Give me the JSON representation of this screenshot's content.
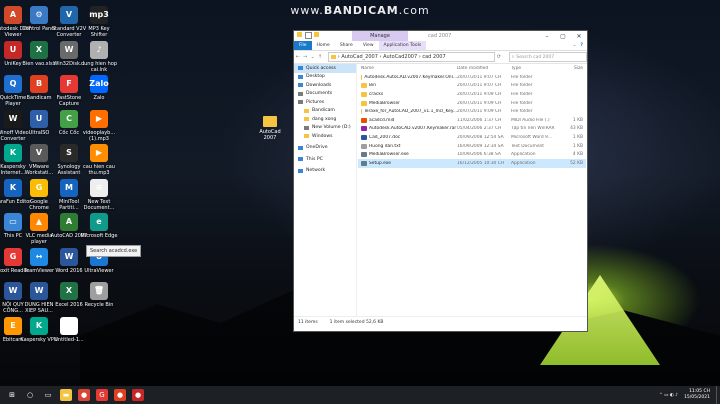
{
  "watermark": {
    "prefix": "www.",
    "brand": "BANDICAM",
    "suffix": ".com"
  },
  "desktop_icons": [
    {
      "label": "Autodesk DWF Viewer",
      "color": "#d04a2a",
      "glyph": "A"
    },
    {
      "label": "Control Panel",
      "color": "#3a79c4",
      "glyph": "⚙"
    },
    {
      "label": "Standard V2V Converter",
      "color": "#2266aa",
      "glyph": "V"
    },
    {
      "label": "MP3 Key Shifter",
      "color": "#222222",
      "glyph": "mp3"
    },
    {
      "label": "UniKey",
      "color": "#c62828",
      "glyph": "U"
    },
    {
      "label": "Bien vao.xlsx",
      "color": "#1e7145",
      "glyph": "X"
    },
    {
      "label": "Win32Disk...",
      "color": "#6a6a6a",
      "glyph": "W"
    },
    {
      "label": "dung hien hop cai.lnk",
      "color": "#b0b0b0",
      "glyph": "♪"
    },
    {
      "label": "QuickTime Player",
      "color": "#1f6fd1",
      "glyph": "Q"
    },
    {
      "label": "Bandicam",
      "color": "#e04020",
      "glyph": "B"
    },
    {
      "label": "FastStone Capture",
      "color": "#e53935",
      "glyph": "F"
    },
    {
      "label": "Zalo",
      "color": "#0068ff",
      "glyph": "Zalo"
    },
    {
      "label": "Winoff Video Converter",
      "color": "#1a1a1a",
      "glyph": "W"
    },
    {
      "label": "UltraISO",
      "color": "#2f5fa8",
      "glyph": "U"
    },
    {
      "label": "Cốc Cốc",
      "color": "#43a047",
      "glyph": "C"
    },
    {
      "label": "videoplayb... (1).mp3",
      "color": "#ff6f00",
      "glyph": "▶"
    },
    {
      "label": "Kaspersky Internet...",
      "color": "#00a88e",
      "glyph": "K"
    },
    {
      "label": "VMware Workstati...",
      "color": "#5a5a5a",
      "glyph": "V"
    },
    {
      "label": "Synology Assistant",
      "color": "#2a2a2a",
      "glyph": "S"
    },
    {
      "label": "cau hien cau thu.mp3",
      "color": "#ff8f00",
      "glyph": "▶"
    },
    {
      "label": "KaraFun Editor",
      "color": "#1565c0",
      "glyph": "K"
    },
    {
      "label": "Google Chrome",
      "color": "#fbbc05",
      "glyph": "G"
    },
    {
      "label": "MiniTool Partiti...",
      "color": "#1565c0",
      "glyph": "M"
    },
    {
      "label": "New Text Document...",
      "color": "#eeeeee",
      "glyph": "≡"
    },
    {
      "label": "This PC",
      "color": "#3a85d6",
      "glyph": "▭"
    },
    {
      "label": "VLC media player",
      "color": "#ff8800",
      "glyph": "▲"
    },
    {
      "label": "AutoCAD 2007",
      "color": "#2e7d32",
      "glyph": "A"
    },
    {
      "label": "Microsoft Edge",
      "color": "#0f9a8a",
      "glyph": "e"
    },
    {
      "label": "Foxit Reader",
      "color": "#e53935",
      "glyph": "G"
    },
    {
      "label": "TeamViewer",
      "color": "#1e88e5",
      "glyph": "↔"
    },
    {
      "label": "Word 2016",
      "color": "#2b579a",
      "glyph": "W"
    },
    {
      "label": "UltraViewer",
      "color": "#1976d2",
      "glyph": "U"
    },
    {
      "label": "NỘI QUY CÔNG...",
      "color": "#2b579a",
      "glyph": "W"
    },
    {
      "label": "DUNG HIEN XIEP SAU...",
      "color": "#2b579a",
      "glyph": "W"
    },
    {
      "label": "Excel 2016",
      "color": "#217346",
      "glyph": "X"
    },
    {
      "label": "Recycle Bin",
      "color": "#9e9e9e",
      "glyph": "🗑"
    },
    {
      "label": "Ebitcam",
      "color": "#ff9800",
      "glyph": "E"
    },
    {
      "label": "Kaspersky VPN",
      "color": "#00a88e",
      "glyph": "K"
    },
    {
      "label": "Untitled-1...",
      "color": "#ffffff",
      "glyph": "1"
    }
  ],
  "tooltip": "Search acadcd.exe",
  "desktop_folder": {
    "label": "AutoCad 2007"
  },
  "explorer": {
    "manage_label": "Manage",
    "window_title": "cad 2007",
    "ribbon_tabs": [
      "File",
      "Home",
      "Share",
      "View",
      "Application Tools"
    ],
    "breadcrumb": "›  AutoCad_2007  ›  AutoCad2007  ›  cad 2007",
    "search_placeholder": "Search cad 2007",
    "nav_items": [
      {
        "label": "Quick access",
        "icon": "star-icon",
        "color": "#3a85d6"
      },
      {
        "label": "Desktop",
        "icon": "desktop-icon",
        "color": "#3a85d6"
      },
      {
        "label": "Downloads",
        "icon": "download-icon",
        "color": "#3a85d6"
      },
      {
        "label": "Documents",
        "icon": "documents-icon",
        "color": "#7a7a7a"
      },
      {
        "label": "Pictures",
        "icon": "pictures-icon",
        "color": "#7a7a7a"
      },
      {
        "label": "Bandicam",
        "icon": "folder-icon",
        "color": "#f5c542"
      },
      {
        "label": "dang xong",
        "icon": "folder-icon",
        "color": "#f5c542"
      },
      {
        "label": "New Volume (D:)",
        "icon": "drive-icon",
        "color": "#7a7a7a"
      },
      {
        "label": "Windows",
        "icon": "folder-icon",
        "color": "#f5c542"
      },
      {
        "label": "OneDrive",
        "icon": "cloud-icon",
        "color": "#3a85d6"
      },
      {
        "label": "This PC",
        "icon": "computer-icon",
        "color": "#3a85d6"
      },
      {
        "label": "Network",
        "icon": "network-icon",
        "color": "#3a85d6"
      }
    ],
    "columns": {
      "name": "Name",
      "date": "Date modified",
      "type": "Type",
      "size": "Size"
    },
    "files": [
      {
        "name": "Autodesk.AutoCAD.v2007.Keymaker.Onl...",
        "date": "20/07/2011 9:07 CH",
        "type": "File folder",
        "size": "",
        "color": "#f5c542"
      },
      {
        "name": "Bin",
        "date": "20/07/2011 9:07 CH",
        "type": "File folder",
        "size": "",
        "color": "#f5c542"
      },
      {
        "name": "cracks",
        "date": "20/07/2011 9:09 CH",
        "type": "File folder",
        "size": "",
        "color": "#f5c542"
      },
      {
        "name": "MediaBrowser",
        "date": "20/07/2011 9:09 CH",
        "type": "File folder",
        "size": "",
        "color": "#f5c542"
      },
      {
        "name": "Teraxe_for_AutoCAD_2007_v1.1_Incl_Key...",
        "date": "20/07/2011 9:09 CH",
        "type": "File folder",
        "size": "",
        "color": "#f5c542"
      },
      {
        "name": "acadcd.mid",
        "date": "11/02/2006 1:37 CH",
        "type": "MIDI Audio File (.)",
        "size": "1 KB",
        "color": "#e65100"
      },
      {
        "name": "Autodesk.AutoCAD.v2007.Keymaker.rar",
        "date": "05/04/2006 2:37 CH",
        "type": "Tập tin nén WinRAR",
        "size": "43 KB",
        "color": "#8e24aa"
      },
      {
        "name": "Cad_2007.doc",
        "date": "20/09/2008 12:54 SA",
        "type": "Microsoft Word 9...",
        "size": "1 KB",
        "color": "#2b579a"
      },
      {
        "name": "Huong dan.txt",
        "date": "16/09/2009 12:34 SA",
        "type": "Text Document",
        "size": "1 KB",
        "color": "#9e9e9e"
      },
      {
        "name": "MediaBrowser.exe",
        "date": "10/09/2006 6:38 SA",
        "type": "Application",
        "size": "4 KB",
        "color": "#607d8b"
      },
      {
        "name": "Setup.exe",
        "date": "16/12/2005 10:30 CH",
        "type": "Application",
        "size": "52 KB",
        "color": "#607d8b"
      }
    ],
    "status_count": "11 items",
    "status_selected": "1 item selected  52,6 KB"
  },
  "taskbar": {
    "apps": [
      {
        "name": "start",
        "glyph": "⊞",
        "color": "#1d2126"
      },
      {
        "name": "search",
        "glyph": "○",
        "color": "#1d2126"
      },
      {
        "name": "task-view",
        "glyph": "▭",
        "color": "#1d2126"
      },
      {
        "name": "explorer",
        "glyph": "▬",
        "color": "#f5c542"
      },
      {
        "name": "chrome",
        "glyph": "●",
        "color": "#db4437"
      },
      {
        "name": "foxit",
        "glyph": "G",
        "color": "#e53935"
      },
      {
        "name": "bandicam",
        "glyph": "●",
        "color": "#e04020"
      },
      {
        "name": "record",
        "glyph": "●",
        "color": "#c62828"
      }
    ],
    "time": "11:05 CH",
    "date": "15/05/2021"
  }
}
